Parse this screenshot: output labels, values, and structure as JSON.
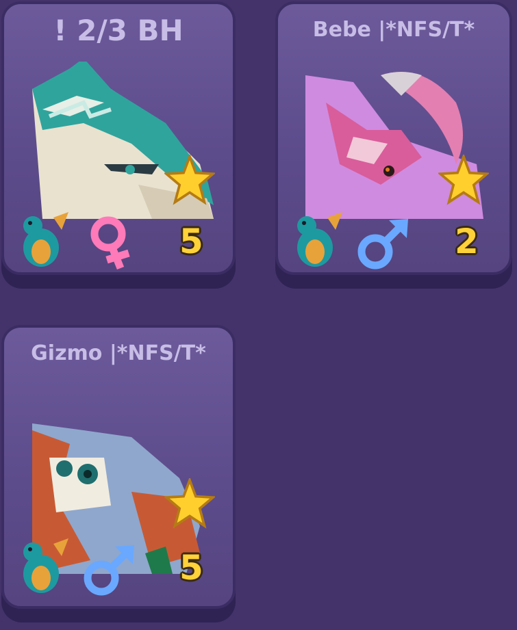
{
  "cards": [
    {
      "name": "! 2/3 BH",
      "gender": "female",
      "gender_icon": "female-symbol-icon",
      "level": "5",
      "species_icon": "dragon-icon",
      "star_icon": "star-icon"
    },
    {
      "name": "Bebe |*NFS/T*",
      "gender": "male",
      "gender_icon": "male-symbol-icon",
      "level": "2",
      "species_icon": "dragon-icon",
      "star_icon": "star-icon"
    },
    {
      "name": "Gizmo |*NFS/T*",
      "gender": "male",
      "gender_icon": "male-symbol-icon",
      "level": "5",
      "species_icon": "dragon-icon",
      "star_icon": "star-icon"
    }
  ],
  "colors": {
    "background": "#43336a",
    "card": "#5d4c8c",
    "title": "#c8bde6",
    "level": "#ffd23a",
    "female": "#ff7ab8",
    "male": "#6aa8ff"
  }
}
